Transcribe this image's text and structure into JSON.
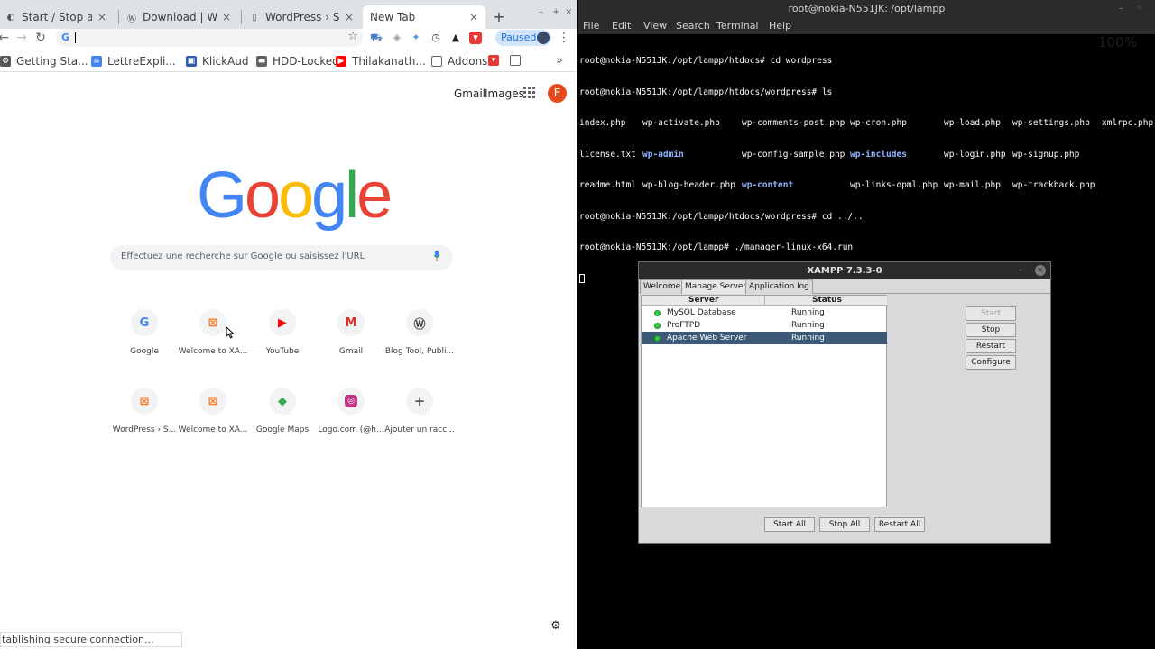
{
  "chrome": {
    "tabs": [
      {
        "title": "Start / Stop an"
      },
      {
        "title": "Download | Word"
      },
      {
        "title": "WordPress › Set"
      },
      {
        "title": "New Tab"
      }
    ],
    "paused_label": "Paused",
    "bookmarks": [
      {
        "label": "Getting Sta..."
      },
      {
        "label": "LettreExpli..."
      },
      {
        "label": "KlickAud"
      },
      {
        "label": "HDD-Locked"
      },
      {
        "label": "Thilakanath..."
      },
      {
        "label": "Addons"
      }
    ],
    "ntp": {
      "gmail_link": "Gmail",
      "images_link": "Images",
      "avatar_letter": "E",
      "search_placeholder": "Effectuez une recherche sur Google ou saisissez l'URL",
      "shortcuts": [
        {
          "label": "Google"
        },
        {
          "label": "Welcome to XA..."
        },
        {
          "label": "YouTube"
        },
        {
          "label": "Gmail"
        },
        {
          "label": "Blog Tool, Publi..."
        },
        {
          "label": "WordPress › S..."
        },
        {
          "label": "Welcome to XA..."
        },
        {
          "label": "Google Maps"
        },
        {
          "label": "Logo.com (@h..."
        },
        {
          "label": "Ajouter un racc..."
        }
      ],
      "status_text": "tablishing secure connection..."
    }
  },
  "terminal": {
    "title": "root@nokia-N551JK: /opt/lampp",
    "menu": [
      "File",
      "Edit",
      "View",
      "Search",
      "Terminal",
      "Help"
    ],
    "lines": {
      "l1": "root@nokia-N551JK:/opt/lampp/htdocs# cd wordpress",
      "l2": "root@nokia-N551JK:/opt/lampp/htdocs/wordpress# ls",
      "l6": "root@nokia-N551JK:/opt/lampp/htdocs/wordpress# cd ../..",
      "l7": "root@nokia-N551JK:/opt/lampp# ./manager-linux-x64.run"
    },
    "ls": {
      "r1": [
        "index.php",
        "wp-activate.php",
        "wp-comments-post.php",
        "wp-cron.php",
        "wp-load.php",
        "wp-settings.php",
        "xmlrpc.php"
      ],
      "r2": [
        "license.txt",
        "wp-admin",
        "wp-config-sample.php",
        "wp-includes",
        "wp-login.php",
        "wp-signup.php"
      ],
      "r3": [
        "readme.html",
        "wp-blog-header.php",
        "wp-content",
        "wp-links-opml.php",
        "wp-mail.php",
        "wp-trackback.php"
      ]
    },
    "watermark": "100%"
  },
  "xampp": {
    "title": "XAMPP 7.3.3-0",
    "tabs": [
      "Welcome",
      "Manage Servers",
      "Application log"
    ],
    "col_server": "Server",
    "col_status": "Status",
    "servers": [
      {
        "name": "MySQL Database",
        "status": "Running"
      },
      {
        "name": "ProFTPD",
        "status": "Running"
      },
      {
        "name": "Apache Web Server",
        "status": "Running"
      }
    ],
    "side_buttons": [
      "Start",
      "Stop",
      "Restart",
      "Configure"
    ],
    "bottom_buttons": [
      "Start All",
      "Stop All",
      "Restart All"
    ]
  }
}
